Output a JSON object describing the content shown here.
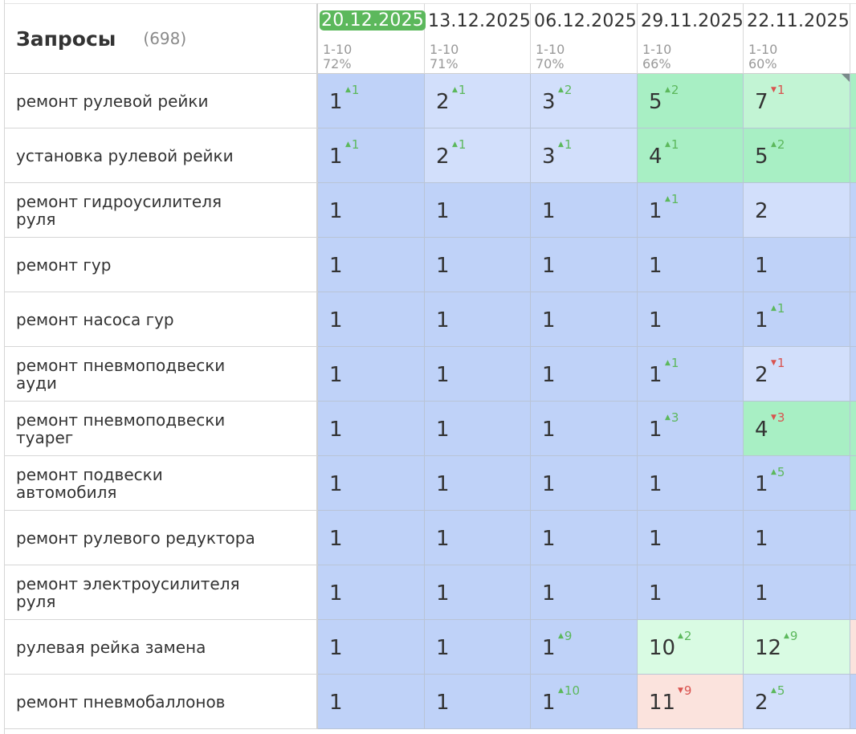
{
  "header": {
    "title": "Запросы",
    "count": "(698)",
    "dates": [
      {
        "date": "20.12.2025",
        "range": "1-10",
        "percent": "72%",
        "active": true
      },
      {
        "date": "13.12.2025",
        "range": "1-10",
        "percent": "71%",
        "active": false
      },
      {
        "date": "06.12.2025",
        "range": "1-10",
        "percent": "70%",
        "active": false
      },
      {
        "date": "29.11.2025",
        "range": "1-10",
        "percent": "66%",
        "active": false
      },
      {
        "date": "22.11.2025",
        "range": "1-10",
        "percent": "60%",
        "active": false
      }
    ]
  },
  "colors": {
    "accent_green": "#5cb85c",
    "delta_down": "#d9534f",
    "cell_blue": "#bfd2f8",
    "cell_light_blue": "#d2dffb",
    "cell_green": "#a8efc4",
    "cell_light_green": "#c2f4d4",
    "cell_pale_green": "#d9fbe3",
    "cell_pink": "#fbe3dd"
  },
  "rows": [
    {
      "query": "ремонт рулевой рейки",
      "cells": [
        {
          "v": "1",
          "d": "1",
          "dir": "up",
          "c": "cell_blue"
        },
        {
          "v": "2",
          "d": "1",
          "dir": "up",
          "c": "cell_light_blue"
        },
        {
          "v": "3",
          "d": "2",
          "dir": "up",
          "c": "cell_light_blue"
        },
        {
          "v": "5",
          "d": "2",
          "dir": "up",
          "c": "cell_green"
        },
        {
          "v": "7",
          "d": "1",
          "dir": "down",
          "c": "cell_light_green",
          "mark": true
        }
      ]
    },
    {
      "query": "установка рулевой рейки",
      "cells": [
        {
          "v": "1",
          "d": "1",
          "dir": "up",
          "c": "cell_blue"
        },
        {
          "v": "2",
          "d": "1",
          "dir": "up",
          "c": "cell_light_blue"
        },
        {
          "v": "3",
          "d": "1",
          "dir": "up",
          "c": "cell_light_blue"
        },
        {
          "v": "4",
          "d": "1",
          "dir": "up",
          "c": "cell_green"
        },
        {
          "v": "5",
          "d": "2",
          "dir": "up",
          "c": "cell_green"
        }
      ]
    },
    {
      "query": "ремонт гидроусилителя руля",
      "cells": [
        {
          "v": "1",
          "d": "",
          "dir": "",
          "c": "cell_blue"
        },
        {
          "v": "1",
          "d": "",
          "dir": "",
          "c": "cell_blue"
        },
        {
          "v": "1",
          "d": "",
          "dir": "",
          "c": "cell_blue"
        },
        {
          "v": "1",
          "d": "1",
          "dir": "up",
          "c": "cell_blue"
        },
        {
          "v": "2",
          "d": "",
          "dir": "",
          "c": "cell_light_blue"
        }
      ]
    },
    {
      "query": "ремонт гур",
      "cells": [
        {
          "v": "1",
          "d": "",
          "dir": "",
          "c": "cell_blue"
        },
        {
          "v": "1",
          "d": "",
          "dir": "",
          "c": "cell_blue"
        },
        {
          "v": "1",
          "d": "",
          "dir": "",
          "c": "cell_blue"
        },
        {
          "v": "1",
          "d": "",
          "dir": "",
          "c": "cell_blue"
        },
        {
          "v": "1",
          "d": "",
          "dir": "",
          "c": "cell_blue"
        }
      ]
    },
    {
      "query": "ремонт насоса гур",
      "cells": [
        {
          "v": "1",
          "d": "",
          "dir": "",
          "c": "cell_blue"
        },
        {
          "v": "1",
          "d": "",
          "dir": "",
          "c": "cell_blue"
        },
        {
          "v": "1",
          "d": "",
          "dir": "",
          "c": "cell_blue"
        },
        {
          "v": "1",
          "d": "",
          "dir": "",
          "c": "cell_blue"
        },
        {
          "v": "1",
          "d": "1",
          "dir": "up",
          "c": "cell_blue"
        }
      ]
    },
    {
      "query": "ремонт пневмоподвески ауди",
      "cells": [
        {
          "v": "1",
          "d": "",
          "dir": "",
          "c": "cell_blue"
        },
        {
          "v": "1",
          "d": "",
          "dir": "",
          "c": "cell_blue"
        },
        {
          "v": "1",
          "d": "",
          "dir": "",
          "c": "cell_blue"
        },
        {
          "v": "1",
          "d": "1",
          "dir": "up",
          "c": "cell_blue"
        },
        {
          "v": "2",
          "d": "1",
          "dir": "down",
          "c": "cell_light_blue"
        }
      ]
    },
    {
      "query": "ремонт пневмоподвески туарег",
      "cells": [
        {
          "v": "1",
          "d": "",
          "dir": "",
          "c": "cell_blue"
        },
        {
          "v": "1",
          "d": "",
          "dir": "",
          "c": "cell_blue"
        },
        {
          "v": "1",
          "d": "",
          "dir": "",
          "c": "cell_blue"
        },
        {
          "v": "1",
          "d": "3",
          "dir": "up",
          "c": "cell_blue"
        },
        {
          "v": "4",
          "d": "3",
          "dir": "down",
          "c": "cell_green"
        }
      ]
    },
    {
      "query": "ремонт подвески автомобиля",
      "cells": [
        {
          "v": "1",
          "d": "",
          "dir": "",
          "c": "cell_blue"
        },
        {
          "v": "1",
          "d": "",
          "dir": "",
          "c": "cell_blue"
        },
        {
          "v": "1",
          "d": "",
          "dir": "",
          "c": "cell_blue"
        },
        {
          "v": "1",
          "d": "",
          "dir": "",
          "c": "cell_blue"
        },
        {
          "v": "1",
          "d": "5",
          "dir": "up",
          "c": "cell_blue"
        }
      ]
    },
    {
      "query": "ремонт рулевого редуктора",
      "cells": [
        {
          "v": "1",
          "d": "",
          "dir": "",
          "c": "cell_blue"
        },
        {
          "v": "1",
          "d": "",
          "dir": "",
          "c": "cell_blue"
        },
        {
          "v": "1",
          "d": "",
          "dir": "",
          "c": "cell_blue"
        },
        {
          "v": "1",
          "d": "",
          "dir": "",
          "c": "cell_blue"
        },
        {
          "v": "1",
          "d": "",
          "dir": "",
          "c": "cell_blue"
        }
      ]
    },
    {
      "query": "ремонт электроусилителя руля",
      "cells": [
        {
          "v": "1",
          "d": "",
          "dir": "",
          "c": "cell_blue"
        },
        {
          "v": "1",
          "d": "",
          "dir": "",
          "c": "cell_blue"
        },
        {
          "v": "1",
          "d": "",
          "dir": "",
          "c": "cell_blue"
        },
        {
          "v": "1",
          "d": "",
          "dir": "",
          "c": "cell_blue"
        },
        {
          "v": "1",
          "d": "",
          "dir": "",
          "c": "cell_blue"
        }
      ]
    },
    {
      "query": "рулевая рейка замена",
      "cells": [
        {
          "v": "1",
          "d": "",
          "dir": "",
          "c": "cell_blue"
        },
        {
          "v": "1",
          "d": "",
          "dir": "",
          "c": "cell_blue"
        },
        {
          "v": "1",
          "d": "9",
          "dir": "up",
          "c": "cell_blue"
        },
        {
          "v": "10",
          "d": "2",
          "dir": "up",
          "c": "cell_pale_green"
        },
        {
          "v": "12",
          "d": "9",
          "dir": "up",
          "c": "cell_pale_green"
        }
      ]
    },
    {
      "query": "ремонт пневмобаллонов",
      "cells": [
        {
          "v": "1",
          "d": "",
          "dir": "",
          "c": "cell_blue"
        },
        {
          "v": "1",
          "d": "",
          "dir": "",
          "c": "cell_blue"
        },
        {
          "v": "1",
          "d": "10",
          "dir": "up",
          "c": "cell_blue"
        },
        {
          "v": "11",
          "d": "9",
          "dir": "down",
          "c": "cell_pink"
        },
        {
          "v": "2",
          "d": "5",
          "dir": "up",
          "c": "cell_light_blue"
        }
      ]
    }
  ],
  "stub_colors": [
    "cell_green",
    "cell_green",
    "cell_blue",
    "cell_blue",
    "cell_blue",
    "cell_blue",
    "cell_green",
    "cell_green",
    "cell_blue",
    "cell_blue",
    "cell_pink",
    "cell_blue"
  ]
}
